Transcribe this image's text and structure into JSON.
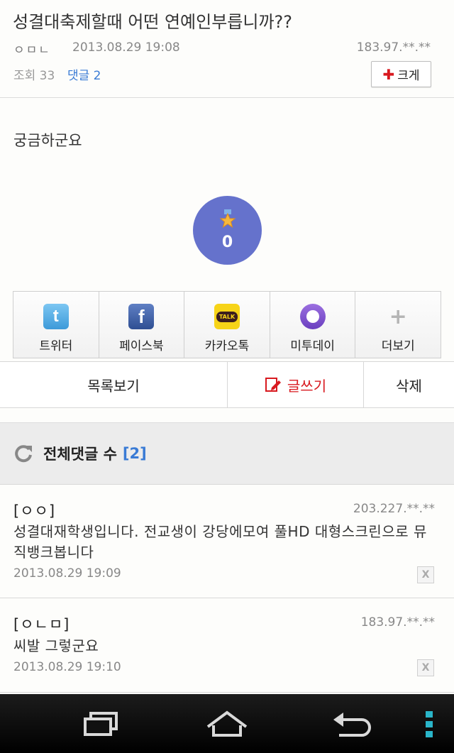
{
  "post": {
    "title": "성결대축제할때 어떤 연예인부릅니까??",
    "author": "ㅇㅁㄴ",
    "date": "2013.08.29 19:08",
    "ip": "183.97.**.**",
    "views_label": "조회 33",
    "comments_label": "댓글 2",
    "enlarge_label": "크게",
    "body": "궁금하군요"
  },
  "recommend": {
    "count": "0"
  },
  "share": [
    {
      "label": "트위터",
      "icon": "twitter-icon",
      "color": "#4aa7e3"
    },
    {
      "label": "페이스북",
      "icon": "facebook-icon",
      "color": "#3b5ea8"
    },
    {
      "label": "카카오톡",
      "icon": "kakaotalk-icon",
      "color": "#f7d418"
    },
    {
      "label": "미투데이",
      "icon": "me2day-icon",
      "color": "#7a4fc9"
    },
    {
      "label": "더보기",
      "icon": "plus-icon",
      "color": "#bbbbbb"
    }
  ],
  "actions": {
    "list": "목록보기",
    "write": "글쓰기",
    "delete": "삭제"
  },
  "comments_header": {
    "title": "전체댓글 수",
    "count": "[2]"
  },
  "comments": [
    {
      "author": "[ㅇㅇ]",
      "ip": "203.227.**.**",
      "text": "성결대재학생입니다. 전교생이 강당에모여 풀HD 대형스크린으로 뮤직뱅크봅니다",
      "date": "2013.08.29 19:09",
      "delete": "X"
    },
    {
      "author": "[ㅇㄴㅁ]",
      "ip": "183.97.**.**",
      "text": "씨발 그렇군요",
      "date": "2013.08.29 19:10",
      "delete": "X"
    }
  ],
  "colors": {
    "accent_blue": "#3a7bd5",
    "recommend": "#6572cc",
    "write_red": "#d8191f",
    "nav_teal": "#2ab5c9"
  }
}
